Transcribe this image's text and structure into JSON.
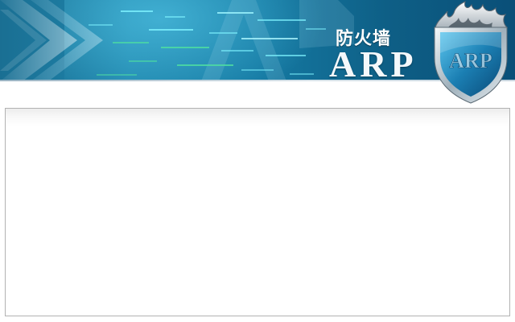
{
  "banner": {
    "title_cn": "防火墙",
    "title_en": "ARP",
    "logo_text": "ARP"
  },
  "colors": {
    "banner_dark": "#0a4f78",
    "banner_light": "#1f86ad",
    "streak_cyan": "#7ff3ff",
    "streak_green": "#4fe0a0",
    "panel_border": "#b2b2b2"
  },
  "icons": [
    "shield-icon",
    "flame-icon",
    "chevron-stripes"
  ]
}
